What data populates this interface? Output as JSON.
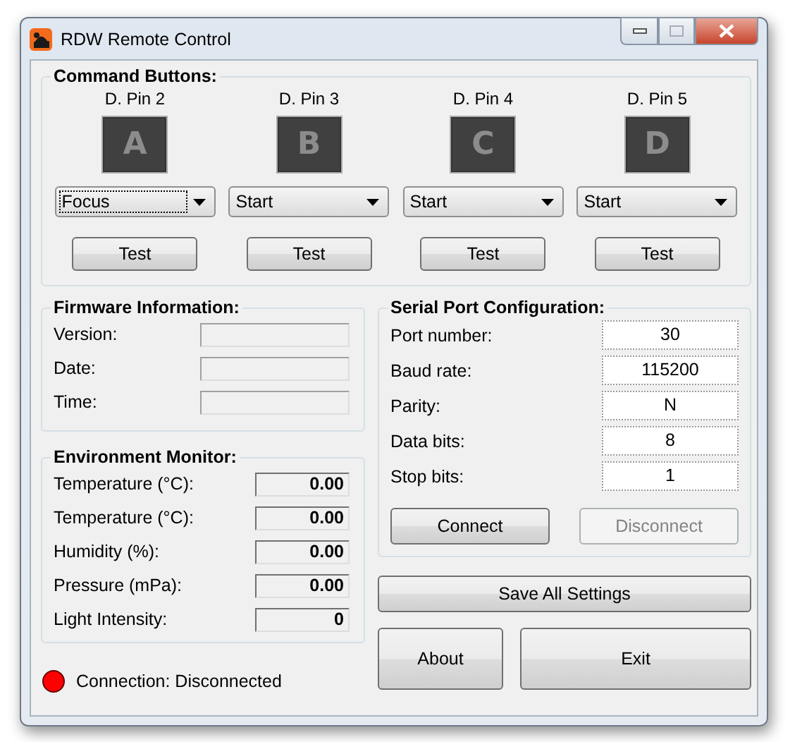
{
  "window": {
    "title": "RDW Remote Control"
  },
  "command_buttons": {
    "title": "Command Buttons:",
    "channels": [
      {
        "pin": "D. Pin 2",
        "letter": "A",
        "mode": "Focus",
        "focused": true,
        "test": "Test"
      },
      {
        "pin": "D. Pin 3",
        "letter": "B",
        "mode": "Start",
        "focused": false,
        "test": "Test"
      },
      {
        "pin": "D. Pin 4",
        "letter": "C",
        "mode": "Start",
        "focused": false,
        "test": "Test"
      },
      {
        "pin": "D. Pin 5",
        "letter": "D",
        "mode": "Start",
        "focused": false,
        "test": "Test"
      }
    ]
  },
  "firmware": {
    "title": "Firmware Information:",
    "fields": [
      {
        "label": "Version:"
      },
      {
        "label": "Date:"
      },
      {
        "label": "Time:"
      }
    ]
  },
  "environment": {
    "title": "Environment Monitor:",
    "readings": [
      {
        "label": "Temperature (°C):",
        "value": "0.00"
      },
      {
        "label": "Temperature (°C):",
        "value": "0.00"
      },
      {
        "label": "Humidity (%):",
        "value": "0.00"
      },
      {
        "label": "Pressure (mPa):",
        "value": "0.00"
      },
      {
        "label": "Light Intensity:",
        "value": "0"
      }
    ]
  },
  "serial": {
    "title": "Serial Port Configuration:",
    "fields": [
      {
        "label": "Port number:",
        "value": "30"
      },
      {
        "label": "Baud rate:",
        "value": "115200"
      },
      {
        "label": "Parity:",
        "value": "N"
      },
      {
        "label": "Data bits:",
        "value": "8"
      },
      {
        "label": "Stop bits:",
        "value": "1"
      }
    ],
    "buttons": [
      {
        "label": "Connect",
        "disabled": false
      },
      {
        "label": "Disconnect",
        "disabled": true
      }
    ]
  },
  "save_button": "Save All Settings",
  "about_button": "About",
  "exit_button": "Exit",
  "status": {
    "text": "Connection: Disconnected",
    "color": "#ff0000"
  }
}
